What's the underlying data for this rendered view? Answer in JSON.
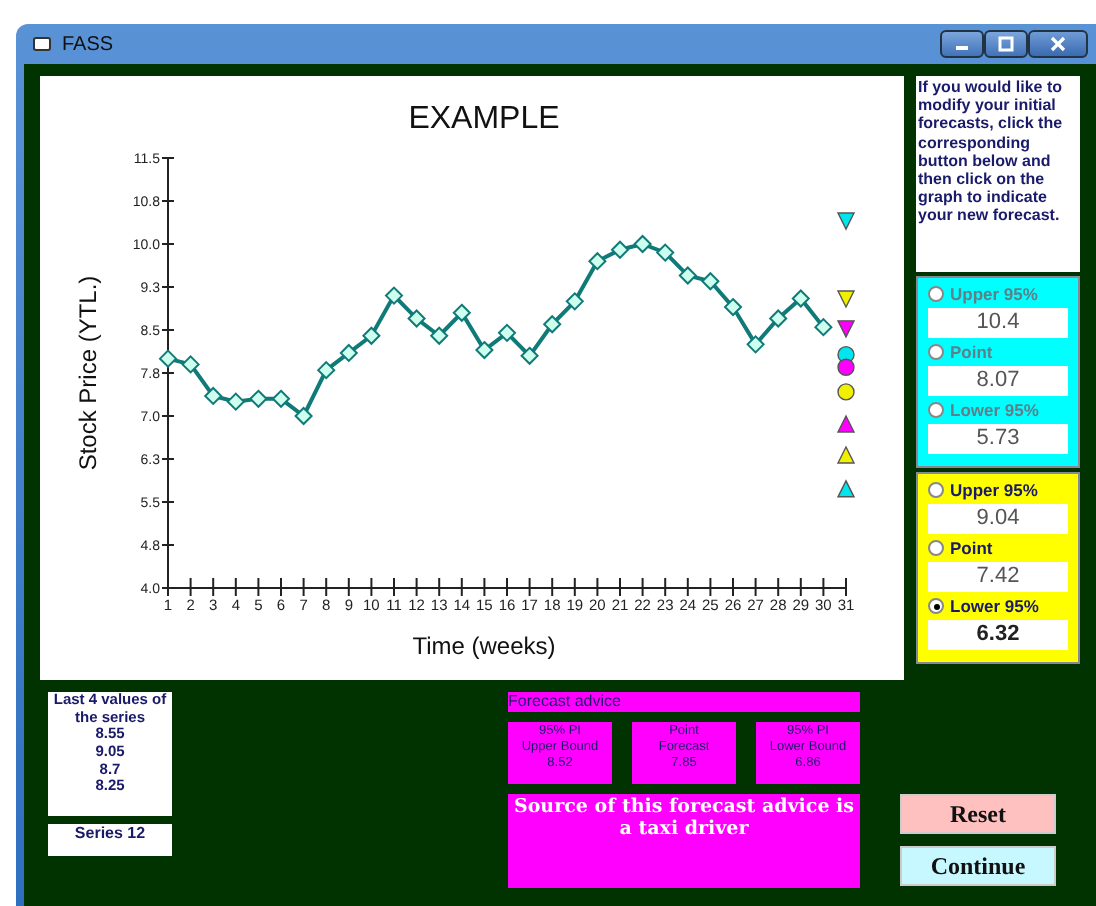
{
  "window": {
    "title": "FASS"
  },
  "chart": {
    "chart_data": {
      "type": "line",
      "title": "EXAMPLE",
      "xlabel": "Time (weeks)",
      "ylabel": "Stock Price (YTL.)",
      "x": [
        1,
        2,
        3,
        4,
        5,
        6,
        7,
        8,
        9,
        10,
        11,
        12,
        13,
        14,
        15,
        16,
        17,
        18,
        19,
        20,
        21,
        22,
        23,
        24,
        25,
        26,
        27,
        28,
        29,
        30,
        31
      ],
      "xlim": [
        1,
        31
      ],
      "ylim": [
        4,
        11.5
      ],
      "xticks": [
        1,
        2,
        3,
        4,
        5,
        6,
        7,
        8,
        9,
        10,
        11,
        12,
        13,
        14,
        15,
        16,
        17,
        18,
        19,
        20,
        21,
        22,
        23,
        24,
        25,
        26,
        27,
        28,
        29,
        30,
        31
      ],
      "yticks": [
        {
          "value": 4,
          "label": "4.0"
        },
        {
          "value": 4.75,
          "label": "4.8"
        },
        {
          "value": 5.5,
          "label": "5.5"
        },
        {
          "value": 6.25,
          "label": "6.3"
        },
        {
          "value": 7,
          "label": "7.0"
        },
        {
          "value": 7.75,
          "label": "7.8"
        },
        {
          "value": 8.5,
          "label": "8.5"
        },
        {
          "value": 9.25,
          "label": "9.3"
        },
        {
          "value": 10,
          "label": "10.0"
        },
        {
          "value": 10.75,
          "label": "10.8"
        },
        {
          "value": 11.5,
          "label": "11.5"
        }
      ],
      "series": [
        {
          "color": "#107a78",
          "marker": "diamond",
          "values": [
            8.0,
            7.9,
            7.35,
            7.25,
            7.3,
            7.3,
            7.0,
            7.8,
            8.1,
            8.4,
            9.1,
            8.7,
            8.4,
            8.8,
            8.15,
            8.45,
            8.05,
            8.6,
            9.0,
            9.7,
            9.9,
            10.0,
            9.85,
            9.45,
            9.35,
            8.9,
            8.25,
            8.7,
            9.05,
            8.55,
            null
          ]
        },
        {
          "color": "#00e5ee",
          "marker": "triangle",
          "values": [
            null,
            null,
            null,
            null,
            null,
            null,
            null,
            null,
            null,
            null,
            null,
            null,
            null,
            null,
            null,
            null,
            null,
            null,
            null,
            null,
            null,
            null,
            null,
            null,
            null,
            null,
            null,
            null,
            null,
            null,
            10.4
          ]
        },
        {
          "color": "#f0f000",
          "marker": "triangle",
          "values": [
            null,
            null,
            null,
            null,
            null,
            null,
            null,
            null,
            null,
            null,
            null,
            null,
            null,
            null,
            null,
            null,
            null,
            null,
            null,
            null,
            null,
            null,
            null,
            null,
            null,
            null,
            null,
            null,
            null,
            null,
            9.04
          ]
        },
        {
          "color": "#ff00ff",
          "marker": "triangle",
          "values": [
            null,
            null,
            null,
            null,
            null,
            null,
            null,
            null,
            null,
            null,
            null,
            null,
            null,
            null,
            null,
            null,
            null,
            null,
            null,
            null,
            null,
            null,
            null,
            null,
            null,
            null,
            null,
            null,
            null,
            null,
            8.52
          ]
        },
        {
          "color": "#00e5ee",
          "marker": "circle",
          "values": [
            null,
            null,
            null,
            null,
            null,
            null,
            null,
            null,
            null,
            null,
            null,
            null,
            null,
            null,
            null,
            null,
            null,
            null,
            null,
            null,
            null,
            null,
            null,
            null,
            null,
            null,
            null,
            null,
            null,
            null,
            8.07
          ]
        },
        {
          "color": "#ff00ff",
          "marker": "circle",
          "values": [
            null,
            null,
            null,
            null,
            null,
            null,
            null,
            null,
            null,
            null,
            null,
            null,
            null,
            null,
            null,
            null,
            null,
            null,
            null,
            null,
            null,
            null,
            null,
            null,
            null,
            null,
            null,
            null,
            null,
            null,
            7.85
          ]
        },
        {
          "color": "#f0f000",
          "marker": "circle",
          "values": [
            null,
            null,
            null,
            null,
            null,
            null,
            null,
            null,
            null,
            null,
            null,
            null,
            null,
            null,
            null,
            null,
            null,
            null,
            null,
            null,
            null,
            null,
            null,
            null,
            null,
            null,
            null,
            null,
            null,
            null,
            7.42
          ]
        },
        {
          "color": "#ff00ff",
          "marker": "triangle",
          "values": [
            null,
            null,
            null,
            null,
            null,
            null,
            null,
            null,
            null,
            null,
            null,
            null,
            null,
            null,
            null,
            null,
            null,
            null,
            null,
            null,
            null,
            null,
            null,
            null,
            null,
            null,
            null,
            null,
            null,
            null,
            6.86
          ]
        },
        {
          "color": "#f0f000",
          "marker": "triangle",
          "values": [
            null,
            null,
            null,
            null,
            null,
            null,
            null,
            null,
            null,
            null,
            null,
            null,
            null,
            null,
            null,
            null,
            null,
            null,
            null,
            null,
            null,
            null,
            null,
            null,
            null,
            null,
            null,
            null,
            null,
            null,
            6.32
          ]
        },
        {
          "color": "#00e5ee",
          "marker": "triangle",
          "values": [
            null,
            null,
            null,
            null,
            null,
            null,
            null,
            null,
            null,
            null,
            null,
            null,
            null,
            null,
            null,
            null,
            null,
            null,
            null,
            null,
            null,
            null,
            null,
            null,
            null,
            null,
            null,
            null,
            null,
            null,
            5.73
          ]
        }
      ]
    }
  },
  "instructions": "If you would like to modify your initial forecasts, click the corresponding button below and then click on the graph to indicate your new forecast.",
  "forecast_panels": [
    {
      "color": "#00ffff",
      "disabled": true,
      "items": [
        {
          "label": "Upper 95%",
          "value": "10.4",
          "selected": false
        },
        {
          "label": "Point",
          "value": "8.07",
          "selected": false
        },
        {
          "label": "Lower 95%",
          "value": "5.73",
          "selected": false
        }
      ]
    },
    {
      "color": "#ffff00",
      "disabled": false,
      "items": [
        {
          "label": "Upper 95%",
          "value": "9.04",
          "selected": false
        },
        {
          "label": "Point",
          "value": "7.42",
          "selected": false
        },
        {
          "label": "Lower 95%",
          "value": "6.32",
          "selected": true
        }
      ]
    }
  ],
  "last_values": {
    "title": "Last 4 values of the series",
    "values": [
      "8.55",
      "9.05",
      "8.7",
      "8.25"
    ]
  },
  "series_label": "Series 12",
  "advice": {
    "title": "Forecast advice",
    "boxes": [
      {
        "lines": [
          "95% PI",
          "Upper Bound",
          "8.52"
        ]
      },
      {
        "lines": [
          "Point",
          "Forecast",
          "7.85"
        ]
      },
      {
        "lines": [
          "95% PI",
          "Lower Bound",
          "6.86"
        ]
      }
    ],
    "source": "Source of this forecast advice is a taxi driver"
  },
  "buttons": [
    {
      "label": "Reset",
      "kind": "reset"
    },
    {
      "label": "Continue",
      "kind": "continue"
    }
  ]
}
